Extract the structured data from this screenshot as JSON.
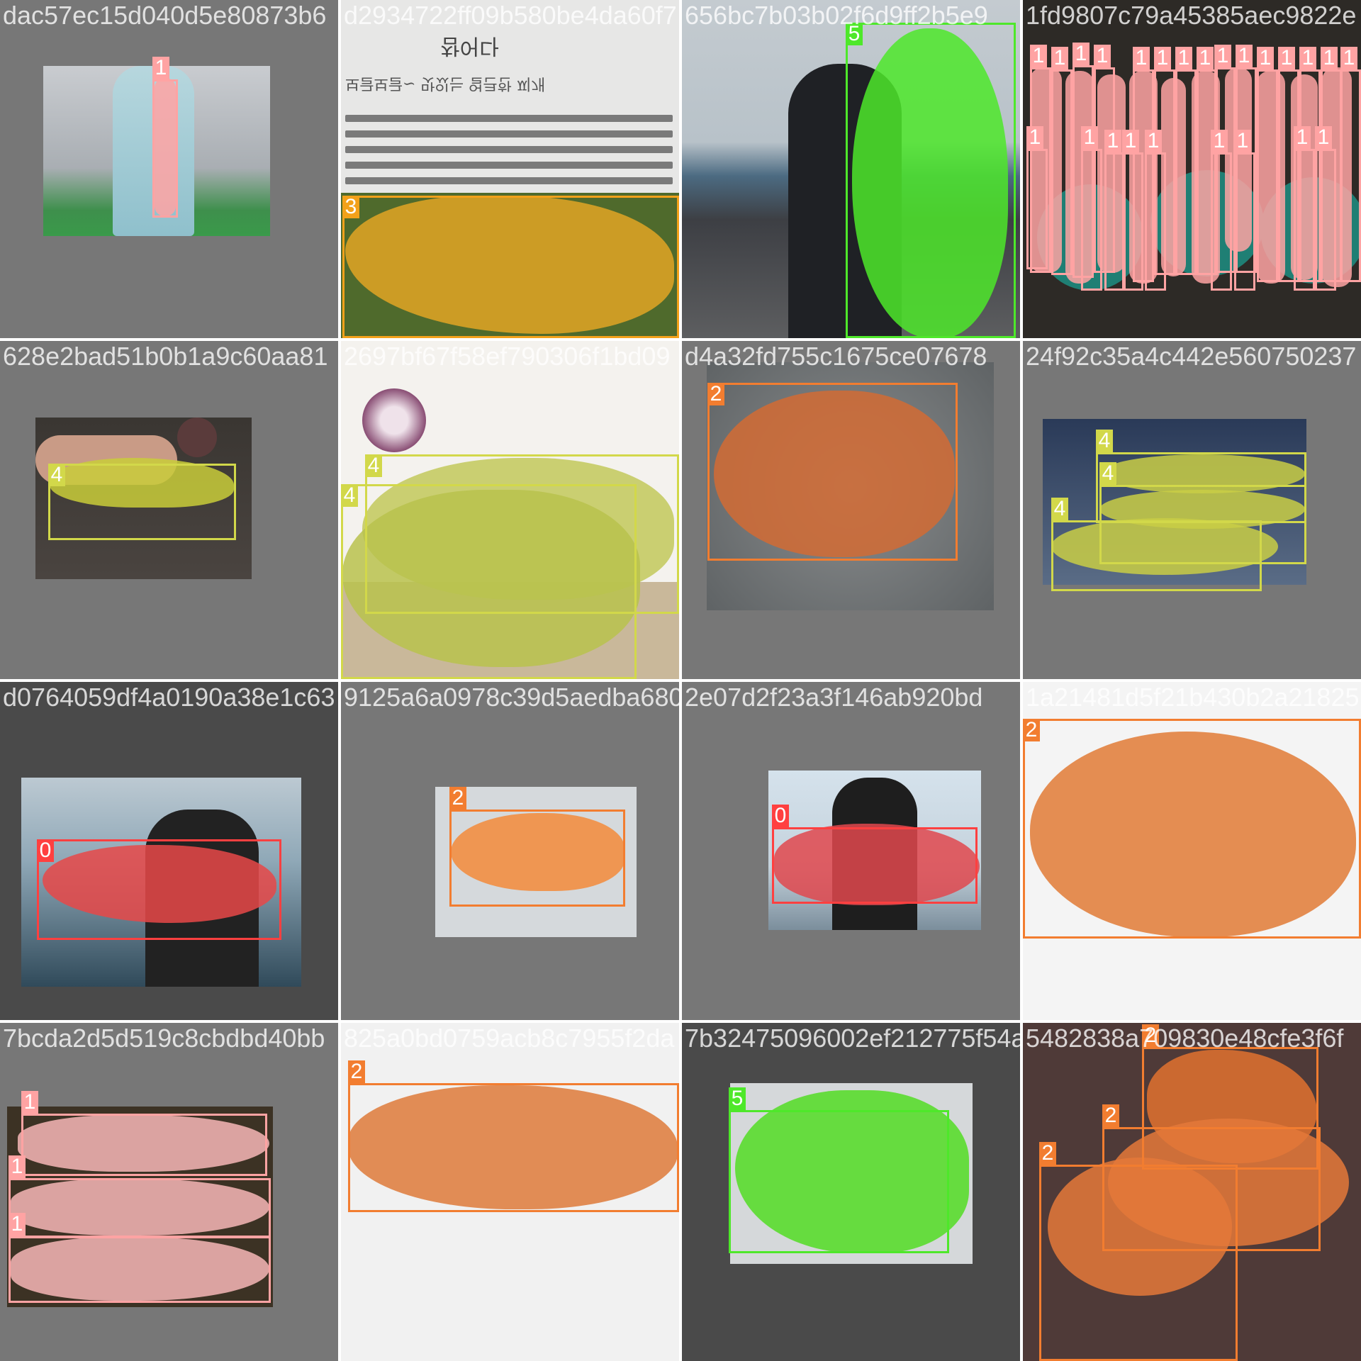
{
  "colors": {
    "0": "#ff4040",
    "1": "#ffa3a3",
    "2": "#f27d30",
    "3": "#f2a11a",
    "4": "#d2d84a",
    "5": "#4ee82a"
  },
  "tiles": [
    {
      "filename": "dac57ec15d040d5e80873b6",
      "filename_overlap": "",
      "labels": [
        "1"
      ]
    },
    {
      "filename": "d2934722ff09b580be4da60f7",
      "filename_overlap": "",
      "labels": [
        "3"
      ],
      "document": {
        "heading": "참어다",
        "subheading": "보글보글~ 맛있는 얼큰한 찌개"
      }
    },
    {
      "filename": "656bc7b03b02f6d9ff2b5e9",
      "filename_overlap": "",
      "labels": [
        "5"
      ]
    },
    {
      "filename": "1fd9807c79a45385aec9822e",
      "filename_overlap": "",
      "labels": [
        "1",
        "1",
        "1",
        "1",
        "1",
        "1",
        "1",
        "1",
        "1",
        "1",
        "1",
        "1",
        "1",
        "1",
        "1",
        "1",
        "1",
        "1",
        "1",
        "1",
        "1",
        "1",
        "1",
        "1"
      ]
    },
    {
      "filename": "628e2bad51b0b1a9c60aa81",
      "filename_overlap": "",
      "labels": [
        "4"
      ]
    },
    {
      "filename": "2697bf67f58ef790306f1bd09",
      "filename_overlap": "",
      "labels": [
        "4",
        "4"
      ]
    },
    {
      "filename": "d4a32fd755c1675ce07678",
      "filename_overlap": "",
      "labels": [
        "2"
      ]
    },
    {
      "filename": "24f92c35a4c442e560750237",
      "filename_overlap": "",
      "labels": [
        "4",
        "4",
        "4"
      ]
    },
    {
      "filename": "d0764059df4a0190a38e1c63",
      "filename_overlap": "",
      "labels": [
        "0"
      ]
    },
    {
      "filename": "9125a6a0978c39d5aedba680",
      "filename_overlap": "",
      "labels": [
        "2"
      ]
    },
    {
      "filename": "2e07d2f23a3f146ab920bd",
      "filename_overlap": "",
      "labels": [
        "0"
      ]
    },
    {
      "filename": "1a21481d5f21b430b2a21825",
      "filename_overlap": "",
      "labels": [
        "2"
      ]
    },
    {
      "filename": "7bcda2d5d519c8cbdbd40bb",
      "filename_overlap": "",
      "labels": [
        "1",
        "1",
        "1"
      ]
    },
    {
      "filename": "825a0bd0759acb8c7955f2da",
      "filename_overlap": "",
      "labels": [
        "2"
      ]
    },
    {
      "filename": "7b32475096002ef212775f54a8",
      "filename_overlap": "",
      "labels": [
        "5"
      ]
    },
    {
      "filename": "5482838a709830e48cfe3f6f",
      "filename_overlap": "",
      "labels": [
        "2",
        "2",
        "2"
      ]
    }
  ]
}
